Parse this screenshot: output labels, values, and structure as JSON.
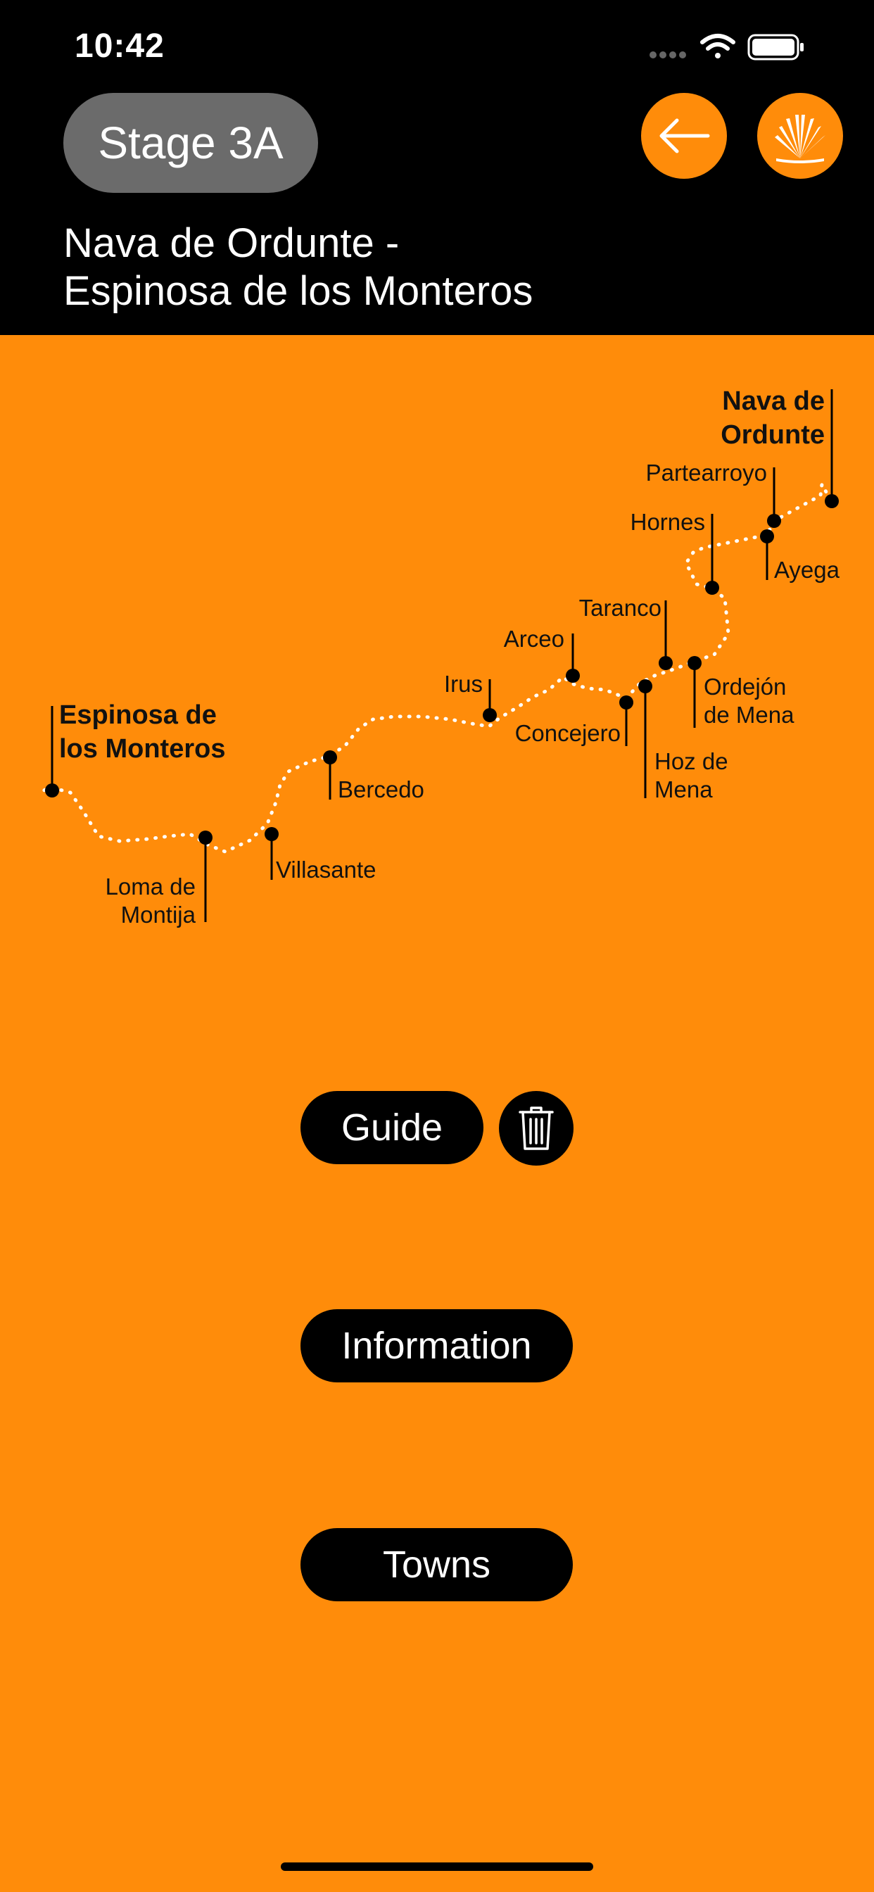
{
  "status_bar": {
    "time": "10:42"
  },
  "header": {
    "stage_label": "Stage 3A",
    "title_line1": "Nava de Ordunte -",
    "title_line2": "Espinosa de los Monteros",
    "back_icon": "arrow-left-icon",
    "shell_icon": "scallop-shell-icon"
  },
  "map": {
    "towns": {
      "nava": "Nava de\nOrdunte",
      "partearroyo": "Partearroyo",
      "hornes": "Hornes",
      "ayega": "Ayega",
      "taranco": "Taranco",
      "arceo": "Arceo",
      "irus": "Irus",
      "concejero": "Concejero",
      "ordejon": "Ordejón\nde Mena",
      "hoz": "Hoz de\nMena",
      "espinosa": "Espinosa de\nlos Monteros",
      "bercedo": "Bercedo",
      "villasante": "Villasante",
      "loma": "Loma de\nMontija"
    }
  },
  "actions": {
    "guide": "Guide",
    "information": "Information",
    "towns": "Towns",
    "delete_icon": "trash-icon"
  },
  "colors": {
    "accent": "#FF8C0A",
    "header_bg": "#000000",
    "pill_bg": "#6b6b6b"
  }
}
